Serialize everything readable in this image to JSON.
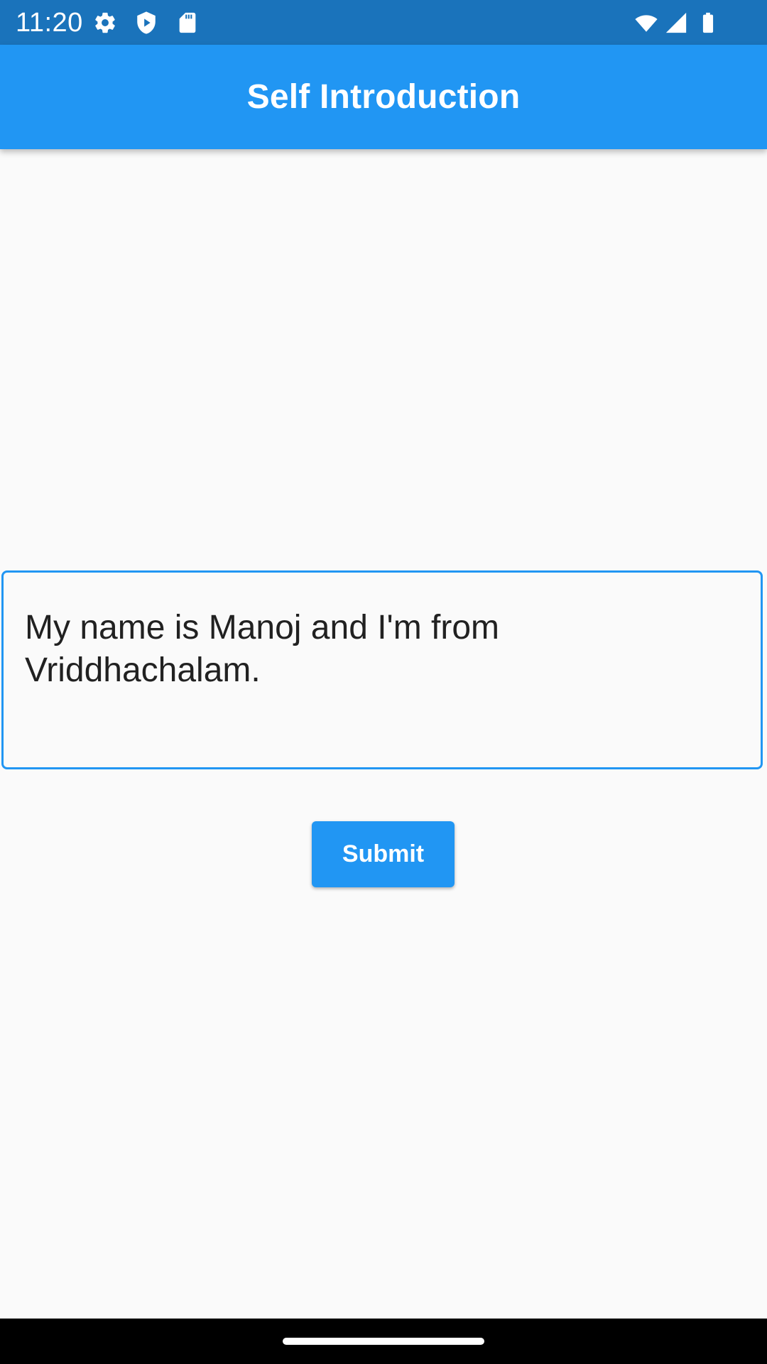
{
  "status_bar": {
    "time": "11:20",
    "left_icons": [
      "gear-icon",
      "shield-play-icon",
      "sd-card-icon"
    ],
    "right_icons": [
      "wifi-icon",
      "cell-signal-icon",
      "battery-icon"
    ],
    "background_color": "#1a73bb"
  },
  "app_bar": {
    "title": "Self Introduction",
    "background_color": "#2196f3"
  },
  "intro_field": {
    "value": "My name is Manoj and I'm from\nVriddhachalam.",
    "border_color": "#2196f3"
  },
  "submit": {
    "label": "Submit",
    "background_color": "#2196f3"
  },
  "nav_bar": {
    "background_color": "#000000"
  }
}
